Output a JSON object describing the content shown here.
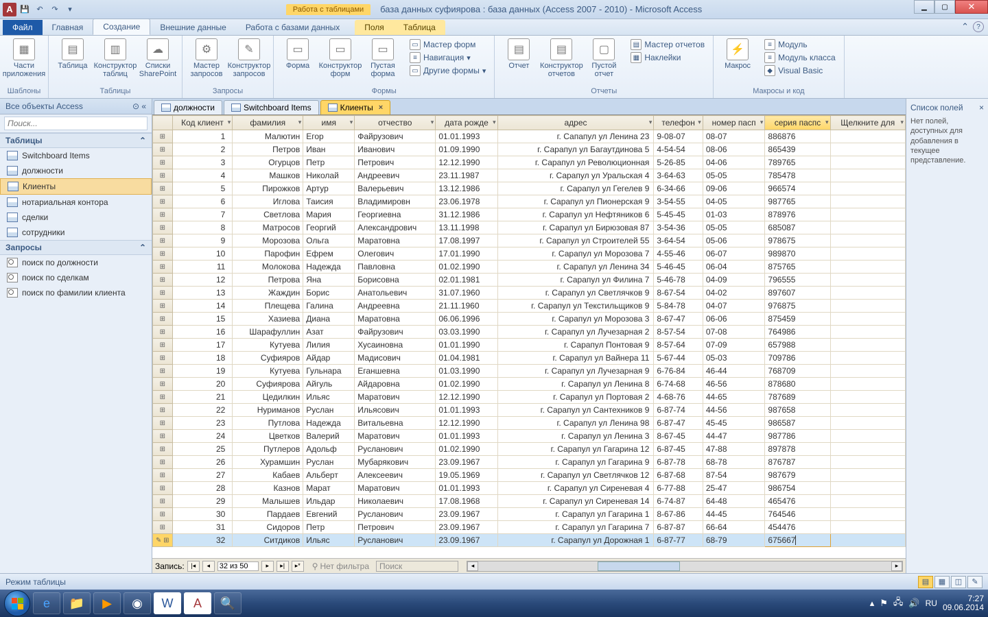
{
  "titlebar": {
    "context_group": "Работа с таблицами",
    "title": "база данных суфиярова : база данных (Access 2007 - 2010)  -  Microsoft Access"
  },
  "ribbon_tabs": {
    "file": "Файл",
    "home": "Главная",
    "create": "Создание",
    "external": "Внешние данные",
    "dbtools": "Работа с базами данных",
    "fields": "Поля",
    "table": "Таблица"
  },
  "ribbon": {
    "templates": {
      "label": "Шаблоны",
      "app_parts": "Части приложения"
    },
    "tables": {
      "label": "Таблицы",
      "table": "Таблица",
      "design": "Конструктор таблиц",
      "sharepoint": "Списки SharePoint"
    },
    "queries": {
      "label": "Запросы",
      "wizard": "Мастер запросов",
      "design": "Конструктор запросов"
    },
    "forms": {
      "label": "Формы",
      "form": "Форма",
      "design": "Конструктор форм",
      "blank": "Пустая форма",
      "form_wiz": "Мастер форм",
      "nav": "Навигация",
      "other": "Другие формы"
    },
    "reports": {
      "label": "Отчеты",
      "report": "Отчет",
      "design": "Конструктор отчетов",
      "blank": "Пустой отчет",
      "wizard": "Мастер отчетов",
      "labels": "Наклейки"
    },
    "macros": {
      "label": "Макросы и код",
      "macro": "Макрос",
      "module": "Модуль",
      "class": "Модуль класса",
      "vb": "Visual Basic"
    }
  },
  "navpane": {
    "header": "Все объекты Access",
    "search_placeholder": "Поиск...",
    "tables_head": "Таблицы",
    "tables": [
      "Switchboard Items",
      "должности",
      "Клиенты",
      "нотариальная контора",
      "сделки",
      "сотрудники"
    ],
    "queries_head": "Запросы",
    "queries": [
      "поиск по должности",
      "поиск по сделкам",
      "поиск по фамилии клиента"
    ]
  },
  "doc_tabs": {
    "t1": "должности",
    "t2": "Switchboard Items",
    "t3": "Клиенты"
  },
  "columns": [
    "Код клиент",
    "фамилия",
    "имя",
    "отчество",
    "дата рожде",
    "адрес",
    "телефон",
    "номер пасп",
    "серия паспс",
    "Щелкните для"
  ],
  "rows": [
    {
      "id": 1,
      "f": "Малютин",
      "n": "Егор",
      "o": "Файрузович",
      "d": "01.01.1993",
      "a": "г. Сапапул ул Ленина 23",
      "t": "9-08-07",
      "p": "08-07",
      "s": "886876"
    },
    {
      "id": 2,
      "f": "Петров",
      "n": "Иван",
      "o": "Иванович",
      "d": "01.09.1990",
      "a": "г. Сарапул ул Багаутдинова 5",
      "t": "4-54-54",
      "p": "08-06",
      "s": "865439"
    },
    {
      "id": 3,
      "f": "Огурцов",
      "n": "Петр",
      "o": "Петрович",
      "d": "12.12.1990",
      "a": "г. Сарапул ул Революционная",
      "t": "5-26-85",
      "p": "04-06",
      "s": "789765"
    },
    {
      "id": 4,
      "f": "Машков",
      "n": "Николай",
      "o": "Андреевич",
      "d": "23.11.1987",
      "a": "г. Сарапул ул Уральская 4",
      "t": "3-64-63",
      "p": "05-05",
      "s": "785478"
    },
    {
      "id": 5,
      "f": "Пирожков",
      "n": "Артур",
      "o": "Валерьевич",
      "d": "13.12.1986",
      "a": "г. Сарапул ул Гегелев 9",
      "t": "6-34-66",
      "p": "09-06",
      "s": "966574"
    },
    {
      "id": 6,
      "f": "Иглова",
      "n": "Таисия",
      "o": "Владимировн",
      "d": "23.06.1978",
      "a": "г. Сарапул ул Пионерская 9",
      "t": "3-54-55",
      "p": "04-05",
      "s": "987765"
    },
    {
      "id": 7,
      "f": "Светлова",
      "n": "Мария",
      "o": "Георгиевна",
      "d": "31.12.1986",
      "a": "г. Сарапул ул Нефтяников 6",
      "t": "5-45-45",
      "p": "01-03",
      "s": "878976"
    },
    {
      "id": 8,
      "f": "Матросов",
      "n": "Георгий",
      "o": "Александрович",
      "d": "13.11.1998",
      "a": "г. Сарапул ул Бирюзовая 87",
      "t": "3-54-36",
      "p": "05-05",
      "s": "685087"
    },
    {
      "id": 9,
      "f": "Морозова",
      "n": "Ольга",
      "o": "Маратовна",
      "d": "17.08.1997",
      "a": "г. Сарапул ул Строителей 55",
      "t": "3-64-54",
      "p": "05-06",
      "s": "978675"
    },
    {
      "id": 10,
      "f": "Парофин",
      "n": "Ефрем",
      "o": "Олегович",
      "d": "17.01.1990",
      "a": "г. Сарапул ул Морозова 7",
      "t": "4-55-46",
      "p": "06-07",
      "s": "989870"
    },
    {
      "id": 11,
      "f": "Молокова",
      "n": "Надежда",
      "o": "Павловна",
      "d": "01.02.1990",
      "a": "г. Сарапул ул Ленина 34",
      "t": "5-46-45",
      "p": "06-04",
      "s": "875765"
    },
    {
      "id": 12,
      "f": "Петрова",
      "n": "Яна",
      "o": "Борисовна",
      "d": "02.01.1981",
      "a": "г. Сарапул ул Филина 7",
      "t": "5-46-78",
      "p": "04-09",
      "s": "796555"
    },
    {
      "id": 13,
      "f": "Жаждин",
      "n": "Борис",
      "o": "Анатольевич",
      "d": "31.07.1960",
      "a": "г. Сарапул ул Светлячков 9",
      "t": "8-67-54",
      "p": "04-02",
      "s": "897607"
    },
    {
      "id": 14,
      "f": "Плещева",
      "n": "Галина",
      "o": "Андреевна",
      "d": "21.11.1960",
      "a": "г. Сарапул ул Текстильщиков 9",
      "t": "5-84-78",
      "p": "04-07",
      "s": "976875"
    },
    {
      "id": 15,
      "f": "Хазиева",
      "n": "Диана",
      "o": "Маратовна",
      "d": "06.06.1996",
      "a": "г. Сарапул ул Морозова 3",
      "t": "8-67-47",
      "p": "06-06",
      "s": "875459"
    },
    {
      "id": 16,
      "f": "Шарафуллин",
      "n": "Азат",
      "o": "Файрузович",
      "d": "03.03.1990",
      "a": "г. Сарапул ул Лучезарная 2",
      "t": "8-57-54",
      "p": "07-08",
      "s": "764986"
    },
    {
      "id": 17,
      "f": "Кутуева",
      "n": "Лилия",
      "o": "Хусаиновна",
      "d": "01.01.1990",
      "a": "г. Сарапул Понтовая 9",
      "t": "8-57-64",
      "p": "07-09",
      "s": "657988"
    },
    {
      "id": 18,
      "f": "Суфияров",
      "n": "Айдар",
      "o": "Мадисович",
      "d": "01.04.1981",
      "a": "г. Сарапул ул Вайнера 11",
      "t": "5-67-44",
      "p": "05-03",
      "s": "709786"
    },
    {
      "id": 19,
      "f": "Кутуева",
      "n": "Гульнара",
      "o": "Еганшевна",
      "d": "01.03.1990",
      "a": "г. Сарапул ул Лучезарная 9",
      "t": "6-76-84",
      "p": "46-44",
      "s": "768709"
    },
    {
      "id": 20,
      "f": "Суфиярова",
      "n": "Айгуль",
      "o": "Айдаровна",
      "d": "01.02.1990",
      "a": "г. Сарапул ул Ленина 8",
      "t": "6-74-68",
      "p": "46-56",
      "s": "878680"
    },
    {
      "id": 21,
      "f": "Цедилкин",
      "n": "Ильяс",
      "o": "Маратович",
      "d": "12.12.1990",
      "a": "г. Сарапул ул Портовая 2",
      "t": "4-68-76",
      "p": "44-65",
      "s": "787689"
    },
    {
      "id": 22,
      "f": "Нуриманов",
      "n": "Руслан",
      "o": "Ильясович",
      "d": "01.01.1993",
      "a": "г. Сарапул ул Сантехников 9",
      "t": "6-87-74",
      "p": "44-56",
      "s": "987658"
    },
    {
      "id": 23,
      "f": "Путлова",
      "n": "Надежда",
      "o": "Витальевна",
      "d": "12.12.1990",
      "a": "г. Сарапул ул Ленина 98",
      "t": "6-87-47",
      "p": "45-45",
      "s": "986587"
    },
    {
      "id": 24,
      "f": "Цветков",
      "n": "Валерий",
      "o": "Маратович",
      "d": "01.01.1993",
      "a": "г. Сарапул ул Ленина 3",
      "t": "8-67-45",
      "p": "44-47",
      "s": "987786"
    },
    {
      "id": 25,
      "f": "Путлеров",
      "n": "Адольф",
      "o": "Русланович",
      "d": "01.02.1990",
      "a": "г. Сарапул ул Гагарина 12",
      "t": "6-87-45",
      "p": "47-88",
      "s": "897878"
    },
    {
      "id": 26,
      "f": "Хурамшин",
      "n": "Руслан",
      "o": "Мубарякович",
      "d": "23.09.1967",
      "a": "г. Сарапул ул Гагарина 9",
      "t": "6-87-78",
      "p": "68-78",
      "s": "876787"
    },
    {
      "id": 27,
      "f": "Кабаев",
      "n": "Альберт",
      "o": "Алексеевич",
      "d": "19.05.1969",
      "a": "г. Сарапул ул Светлячков 12",
      "t": "6-87-68",
      "p": "87-54",
      "s": "987679"
    },
    {
      "id": 28,
      "f": "Казнов",
      "n": "Марат",
      "o": "Маратович",
      "d": "01.01.1993",
      "a": "г. Сарапул ул Сиреневая 4",
      "t": "6-77-88",
      "p": "25-47",
      "s": "986754"
    },
    {
      "id": 29,
      "f": "Малышев",
      "n": "Ильдар",
      "o": "Николаевич",
      "d": "17.08.1968",
      "a": "г. Сарапул ул Сиреневая 14",
      "t": "6-74-87",
      "p": "64-48",
      "s": "465476"
    },
    {
      "id": 30,
      "f": "Пардаев",
      "n": "Евгений",
      "o": "Русланович",
      "d": "23.09.1967",
      "a": "г. Сарапул ул Гагарина 1",
      "t": "8-67-86",
      "p": "44-45",
      "s": "764546"
    },
    {
      "id": 31,
      "f": "Сидоров",
      "n": "Петр",
      "o": "Петрович",
      "d": "23.09.1967",
      "a": "г. Сарапул ул Гагарина 7",
      "t": "6-87-87",
      "p": "66-64",
      "s": "454476"
    },
    {
      "id": 32,
      "f": "Ситдиков",
      "n": "Ильяс",
      "o": "Русланович",
      "d": "23.09.1967",
      "a": "г. Сарапул ул Дорожная 1",
      "t": "6-87-77",
      "p": "68-79",
      "s": "675667"
    }
  ],
  "recnav": {
    "label": "Запись:",
    "pos": "32 из 50",
    "nofilter": "Нет фильтра",
    "search": "Поиск"
  },
  "fieldpane": {
    "title": "Список полей",
    "body": "Нет полей, доступных для добавления в текущее представление."
  },
  "statusbar": {
    "mode": "Режим таблицы"
  },
  "taskbar": {
    "lang": "RU",
    "time": "7:27",
    "date": "09.06.2014"
  }
}
